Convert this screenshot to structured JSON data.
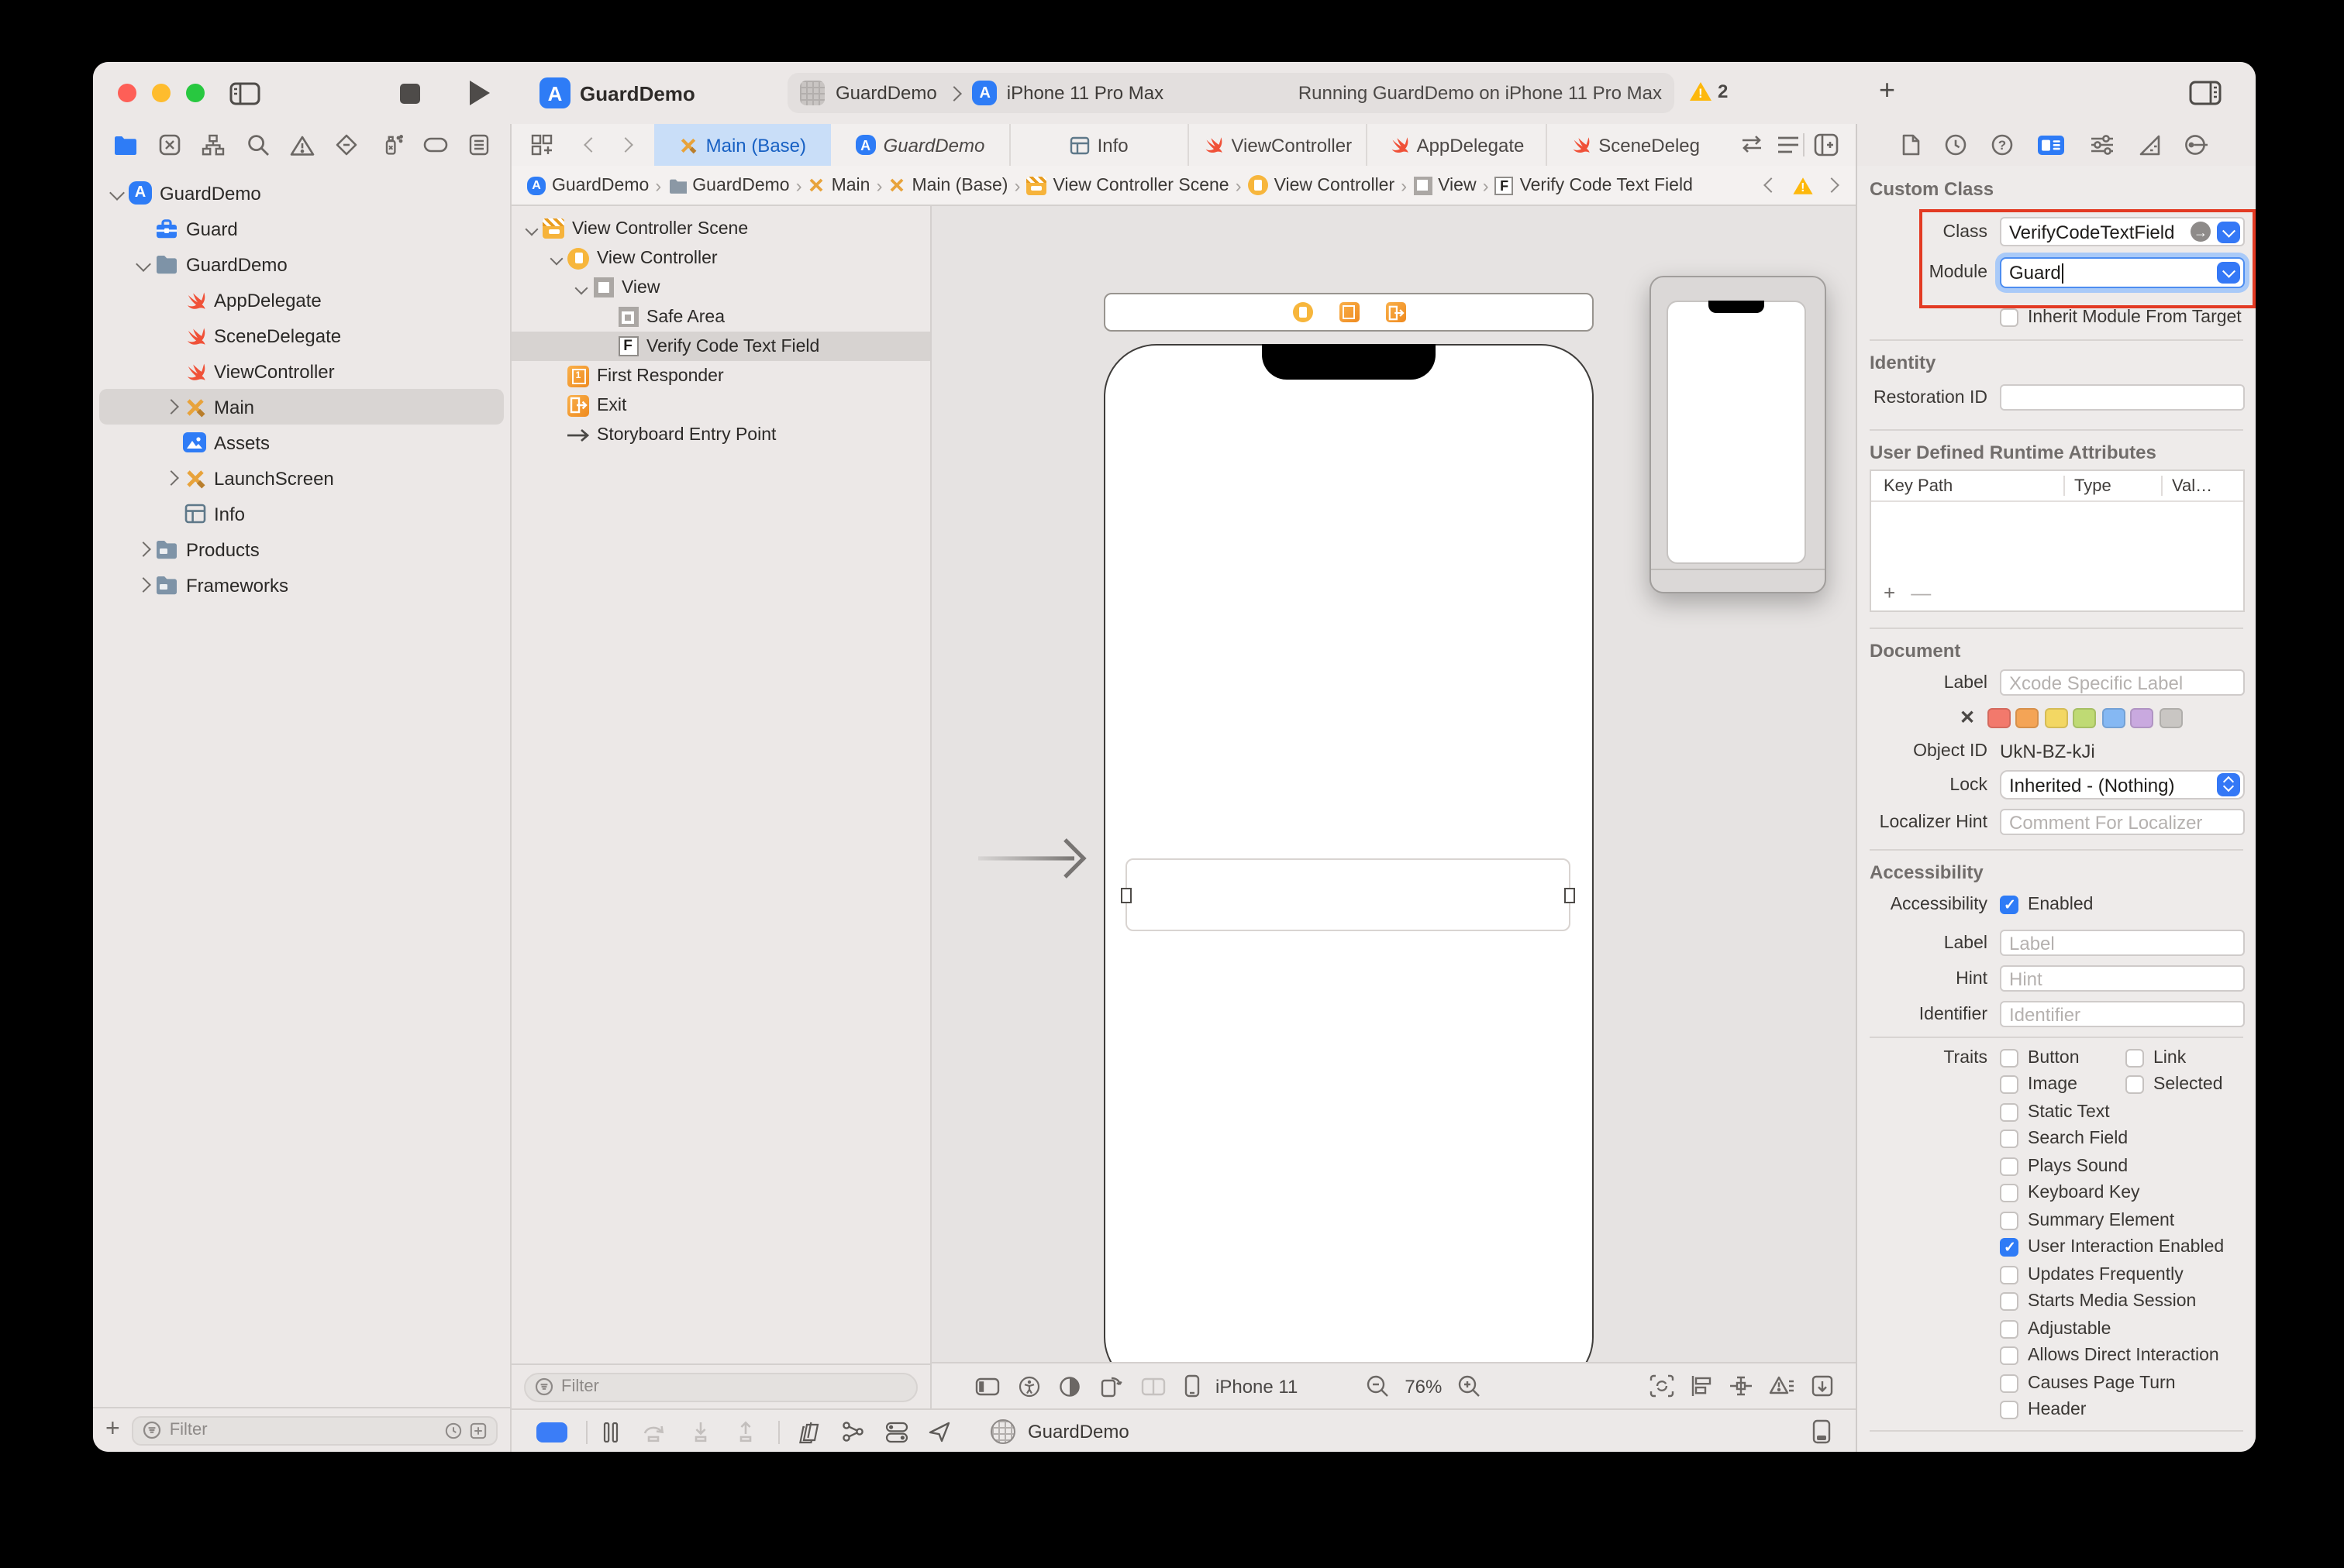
{
  "titlebar": {
    "title": "GuardDemo",
    "scheme_project": "GuardDemo",
    "scheme_destination": "iPhone 11 Pro Max",
    "status": "Running GuardDemo on iPhone 11 Pro Max",
    "warning_count": "2",
    "new_tab_label": "+"
  },
  "navigator": {
    "filter_placeholder": "Filter",
    "add_label": "+",
    "tree": [
      {
        "label": "GuardDemo"
      },
      {
        "label": "Guard"
      },
      {
        "label": "GuardDemo"
      },
      {
        "label": "AppDelegate"
      },
      {
        "label": "SceneDelegate"
      },
      {
        "label": "ViewController"
      },
      {
        "label": "Main"
      },
      {
        "label": "Assets"
      },
      {
        "label": "LaunchScreen"
      },
      {
        "label": "Info"
      },
      {
        "label": "Products"
      },
      {
        "label": "Frameworks"
      }
    ]
  },
  "editor": {
    "tabs": [
      {
        "label": "Main (Base)"
      },
      {
        "label": "GuardDemo"
      },
      {
        "label": "Info"
      },
      {
        "label": "ViewController"
      },
      {
        "label": "AppDelegate"
      },
      {
        "label": "SceneDeleg"
      }
    ],
    "jump_bar": [
      {
        "label": "GuardDemo"
      },
      {
        "label": "GuardDemo"
      },
      {
        "label": "Main"
      },
      {
        "label": "Main (Base)"
      },
      {
        "label": "View Controller Scene"
      },
      {
        "label": "View Controller"
      },
      {
        "label": "View"
      },
      {
        "label": "Verify Code Text Field"
      }
    ]
  },
  "outline": {
    "filter_placeholder": "Filter",
    "rows": [
      {
        "label": "View Controller Scene"
      },
      {
        "label": "View Controller"
      },
      {
        "label": "View"
      },
      {
        "label": "Safe Area"
      },
      {
        "label": "Verify Code Text Field"
      },
      {
        "label": "First Responder"
      },
      {
        "label": "Exit"
      },
      {
        "label": "Storyboard Entry Point"
      }
    ]
  },
  "canvas": {
    "device_label": "iPhone 11",
    "zoom_level": "76%"
  },
  "debugbar": {
    "app_label": "GuardDemo"
  },
  "inspector": {
    "custom_class": {
      "header": "Custom Class",
      "class_label": "Class",
      "class_value": "VerifyCodeTextField",
      "module_label": "Module",
      "module_value": "Guard",
      "inherit_label": "Inherit Module From Target"
    },
    "identity": {
      "header": "Identity",
      "restoration_label": "Restoration ID"
    },
    "runtime_attributes": {
      "header": "User Defined Runtime Attributes",
      "col_keypath": "Key Path",
      "col_type": "Type",
      "col_value": "Val…",
      "add_label": "+",
      "remove_label": "—"
    },
    "document": {
      "header": "Document",
      "label_label": "Label",
      "label_placeholder": "Xcode Specific Label",
      "object_id_label": "Object ID",
      "object_id_value": "UkN-BZ-kJi",
      "lock_label": "Lock",
      "lock_value": "Inherited - (Nothing)",
      "localizer_label": "Localizer Hint",
      "localizer_placeholder": "Comment For Localizer",
      "swatch_clear": "✕",
      "swatches": [
        "#F2796C",
        "#F4A456",
        "#F3D763",
        "#BFDA74",
        "#85B8F3",
        "#C9A9DF",
        "#C9C6C3"
      ]
    },
    "accessibility": {
      "header": "Accessibility",
      "accessibility_label": "Accessibility",
      "enabled_label": "Enabled",
      "label_label": "Label",
      "label_placeholder": "Label",
      "hint_label": "Hint",
      "hint_placeholder": "Hint",
      "identifier_label": "Identifier",
      "identifier_placeholder": "Identifier",
      "traits_label": "Traits",
      "traits": [
        {
          "label": "Button",
          "checked": false
        },
        {
          "label": "Link",
          "checked": false
        },
        {
          "label": "Image",
          "checked": false
        },
        {
          "label": "Selected",
          "checked": false
        },
        {
          "label": "Static Text",
          "checked": false
        },
        {
          "label": "Search Field",
          "checked": false
        },
        {
          "label": "Plays Sound",
          "checked": false
        },
        {
          "label": "Keyboard Key",
          "checked": false
        },
        {
          "label": "Summary Element",
          "checked": false
        },
        {
          "label": "User Interaction Enabled",
          "checked": true
        },
        {
          "label": "Updates Frequently",
          "checked": false
        },
        {
          "label": "Starts Media Session",
          "checked": false
        },
        {
          "label": "Adjustable",
          "checked": false
        },
        {
          "label": "Allows Direct Interaction",
          "checked": false
        },
        {
          "label": "Causes Page Turn",
          "checked": false
        },
        {
          "label": "Header",
          "checked": false
        }
      ]
    },
    "colors": {
      "accent_blue": "#3478F6",
      "annotation_red": "#E33A23",
      "warning_yellow": "#FDB80C"
    }
  }
}
